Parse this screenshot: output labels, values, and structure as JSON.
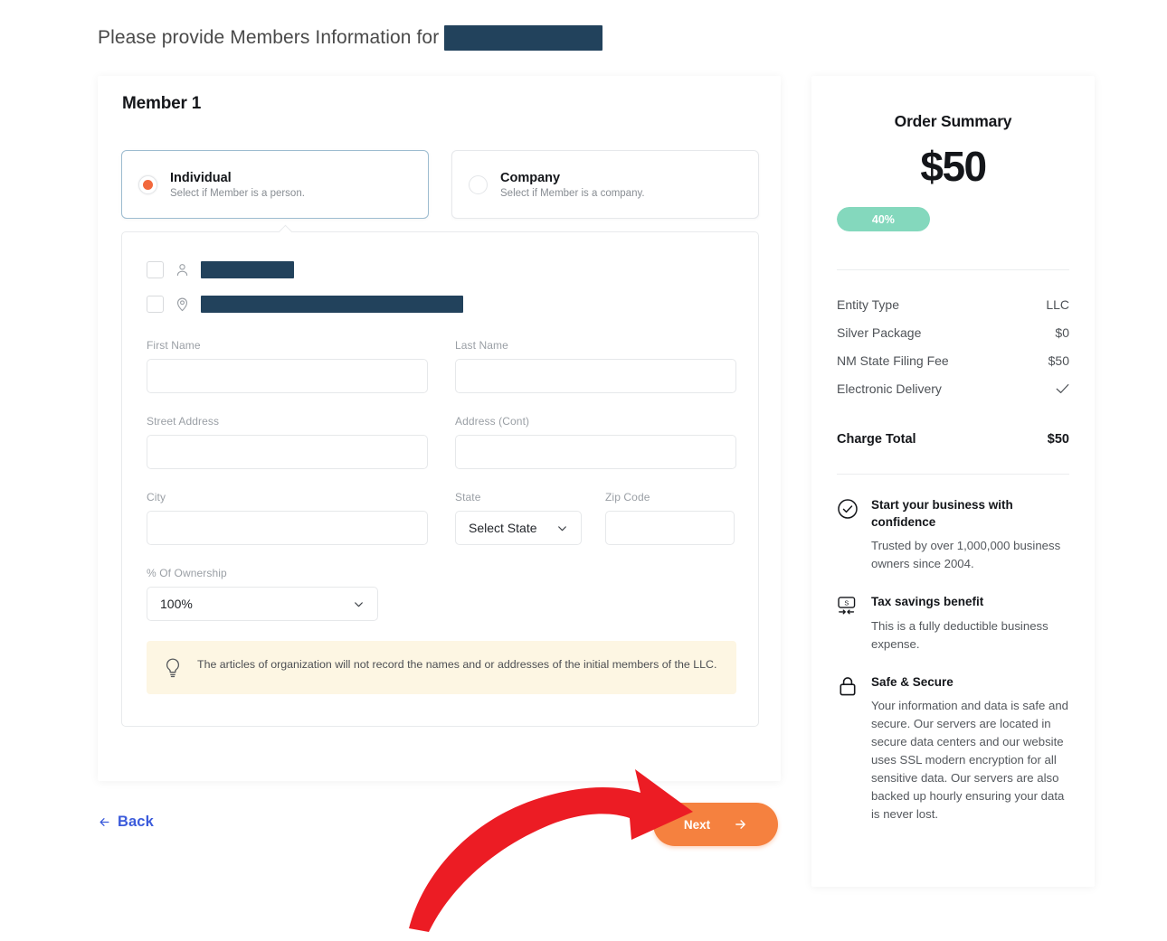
{
  "page": {
    "title_prefix": "Please provide Members Information for",
    "redacted_company": ""
  },
  "form": {
    "member_heading": "Member 1",
    "type_options": [
      {
        "id": "individual",
        "title": "Individual",
        "subtitle": "Select if Member is a person.",
        "selected": true
      },
      {
        "id": "company",
        "title": "Company",
        "subtitle": "Select if Member is a company.",
        "selected": false
      }
    ],
    "saved_rows": [
      {
        "icon": "person-icon",
        "value": ""
      },
      {
        "icon": "location-pin-icon",
        "value": ""
      }
    ],
    "fields": {
      "first_name": {
        "label": "First Name",
        "value": "",
        "placeholder": ""
      },
      "last_name": {
        "label": "Last Name",
        "value": "",
        "placeholder": ""
      },
      "street_address": {
        "label": "Street Address",
        "value": "",
        "placeholder": ""
      },
      "address_cont": {
        "label": "Address (Cont)",
        "value": "",
        "placeholder": ""
      },
      "city": {
        "label": "City",
        "value": "",
        "placeholder": ""
      },
      "state": {
        "label": "State",
        "value": "Select State"
      },
      "zip_code": {
        "label": "Zip Code",
        "value": "",
        "placeholder": ""
      },
      "ownership": {
        "label": "% Of Ownership",
        "value": "100%"
      }
    },
    "notice": "The articles of organization will not record the names and or addresses of the initial members of the LLC."
  },
  "nav": {
    "back_label": "Back",
    "next_label": "Next"
  },
  "summary": {
    "title": "Order Summary",
    "price": "$50",
    "progress_label": "40%",
    "progress_percent": 40,
    "line_items": [
      {
        "label": "Entity Type",
        "value": "LLC",
        "is_check": false
      },
      {
        "label": "Silver Package",
        "value": "$0",
        "is_check": false
      },
      {
        "label": "NM State Filing Fee",
        "value": "$50",
        "is_check": false
      },
      {
        "label": "Electronic Delivery",
        "value": "",
        "is_check": true
      }
    ],
    "total_label": "Charge Total",
    "total_value": "$50",
    "badges": [
      {
        "icon": "check-circle-icon",
        "title": "Start your business with confidence",
        "body": "Trusted by over 1,000,000 business owners since 2004."
      },
      {
        "icon": "money-transfer-icon",
        "title": "Tax savings benefit",
        "body": "This is a fully deductible business expense."
      },
      {
        "icon": "lock-icon",
        "title": "Safe & Secure",
        "body": "Your information and data is safe and secure. Our servers are located in secure data centers and our website uses SSL modern encryption for all sensitive data. Our servers are also backed up hourly ensuring your data is never lost."
      }
    ]
  },
  "annotation": {
    "type": "red-curved-arrow",
    "color": "#ec1c24",
    "points_to": "next-button"
  },
  "colors": {
    "accent_orange": "#f5813f",
    "link_blue": "#3b5bdb",
    "progress_green": "#84d8bd",
    "notice_bg": "#fdf6e3",
    "redaction": "#22425c"
  }
}
